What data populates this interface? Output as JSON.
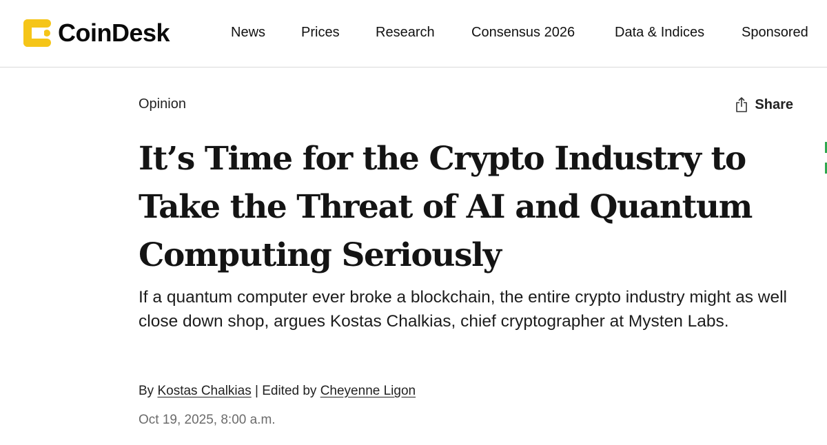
{
  "site": {
    "name": "CoinDesk",
    "brand_color": "#F5C518"
  },
  "nav": {
    "items": [
      {
        "label": "News"
      },
      {
        "label": "Prices"
      },
      {
        "label": "Research"
      },
      {
        "label": "Consensus 2026"
      },
      {
        "label": "Data & Indices"
      },
      {
        "label": "Sponsored"
      }
    ]
  },
  "article": {
    "section": "Opinion",
    "share_label": "Share",
    "share_icon": "share-icon",
    "headline": "It’s Time for the Crypto Industry to Take the Threat of AI and Quantum Computing Seriously",
    "dek": "If a quantum computer ever broke a blockchain, the entire crypto industry might as well close down shop, argues Kostas Chalkias, chief cryptographer at Mysten Labs.",
    "byline": {
      "by_prefix": "By",
      "author": "Kostas Chalkias",
      "separator": "| Edited by",
      "editor": "Cheyenne Ligon"
    },
    "date": "Oct 19, 2025, 8:00 a.m."
  }
}
